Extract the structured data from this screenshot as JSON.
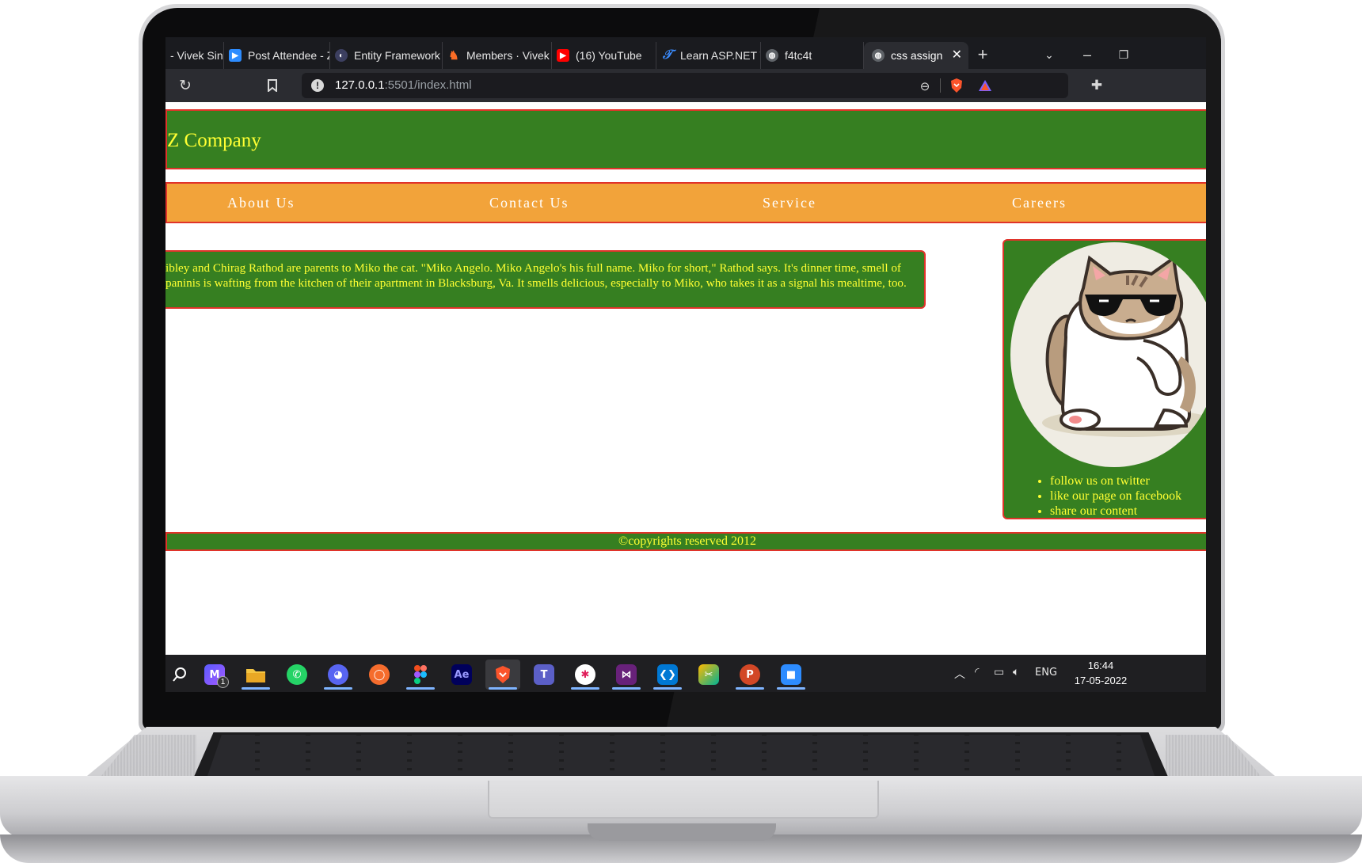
{
  "browser": {
    "tabs": [
      {
        "label": "- Vivek Sing",
        "icon": "globe-icon"
      },
      {
        "label": "Post Attendee - Z",
        "icon": "zoom-icon"
      },
      {
        "label": "Entity Framework",
        "icon": "entity-framework-icon"
      },
      {
        "label": "Members · Vivek",
        "icon": "gitlab-icon"
      },
      {
        "label": "(16) YouTube",
        "icon": "youtube-icon"
      },
      {
        "label": "Learn ASP.NET W",
        "icon": "learn-icon"
      },
      {
        "label": "f4tc4t",
        "icon": "globe-icon"
      },
      {
        "label": "css assign",
        "icon": "globe-icon",
        "active": true
      }
    ],
    "url_host": "127.0.0.1",
    "url_rest": ":5501/index.html"
  },
  "page": {
    "company": "Z Company",
    "nav": [
      "About Us",
      "Contact Us",
      "Service",
      "Careers"
    ],
    "article": "ibley and Chirag Rathod are parents to Miko the cat. \"Miko Angelo. Miko Angelo's his full name. Miko for short,\" Rathod says. It's dinner time, smell of paninis is wafting from the kitchen of their apartment in Blacksburg, Va. It smells delicious, especially to Miko, who takes it as a signal his mealtime, too.",
    "aside_links": [
      "follow us on twitter",
      "like our page on facebook",
      "share our content"
    ],
    "footer": "©copyrights reserved 2012"
  },
  "taskbar": {
    "apps": [
      "search-icon",
      "notes-app-icon",
      "file-explorer-icon",
      "whatsapp-icon",
      "discord-icon",
      "origin-icon",
      "figma-icon",
      "after-effects-icon",
      "brave-icon",
      "teams-icon",
      "slack-icon",
      "visual-studio-icon",
      "vscode-icon",
      "snip-tool-icon",
      "powerpoint-icon",
      "zoom-icon"
    ],
    "ae_label": "Ae",
    "notes_badge": "1",
    "lang": "ENG",
    "time": "16:44",
    "date": "17-05-2022"
  },
  "colors": {
    "page_green": "#367f21",
    "nav_orange": "#f2a33a",
    "border_red": "#e0332a",
    "text_yellow": "#ffff33"
  }
}
